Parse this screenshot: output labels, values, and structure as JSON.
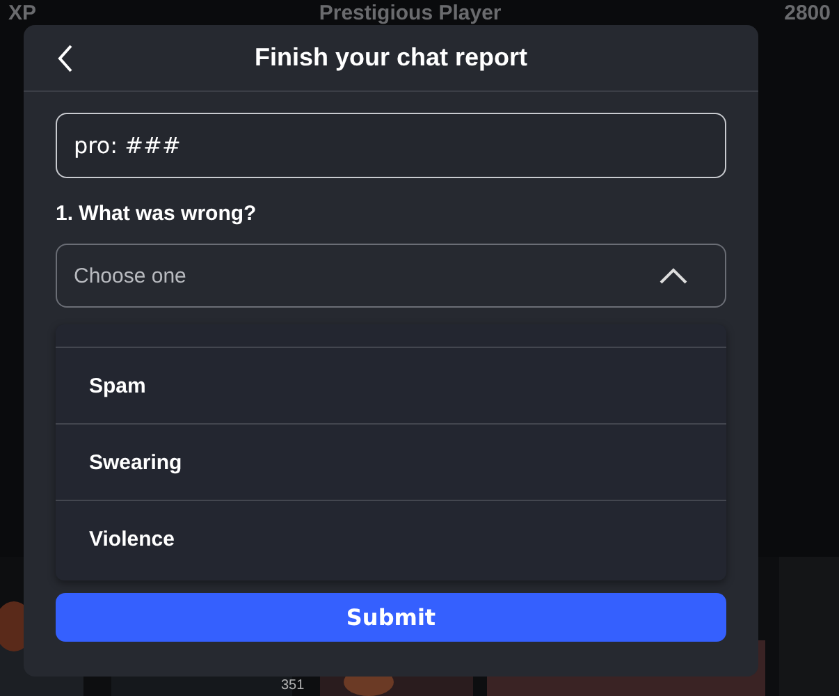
{
  "background": {
    "header": [
      "XP",
      "Prestigious Player",
      "2800"
    ],
    "footer_number": "351"
  },
  "dialog": {
    "title": "Finish your chat report",
    "field": {
      "value": "pro: ###"
    },
    "question": "1. What was wrong?",
    "dropdown": {
      "placeholder": "Choose one",
      "expanded": true,
      "options": [
        {
          "label": "Spam"
        },
        {
          "label": "Swearing"
        },
        {
          "label": "Violence"
        }
      ]
    },
    "submit": "Submit"
  }
}
